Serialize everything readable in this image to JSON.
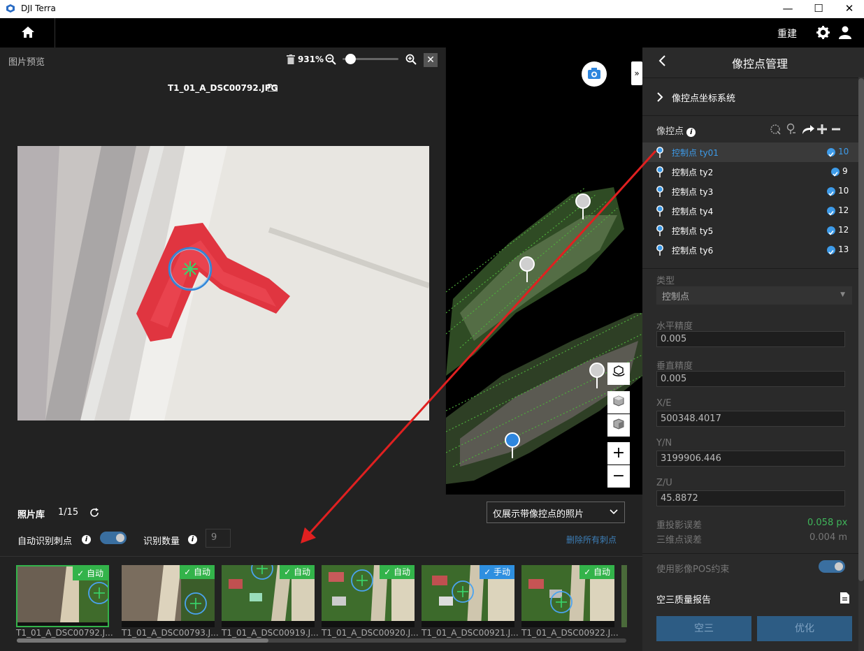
{
  "app": {
    "title": "DJI Terra"
  },
  "window_controls": {
    "minimize": "—",
    "maximize": "☐",
    "close": "✕"
  },
  "topbar": {
    "rebuild_label": "重建"
  },
  "preview": {
    "title": "图片预览",
    "zoom_level": "931%",
    "zoom_slider_value": 0.1,
    "filename": "T1_01_A_DSC00792.JPG",
    "close_label": "✕"
  },
  "map_buttons": {
    "zoom_in": "+",
    "zoom_out": "−",
    "expand": "»"
  },
  "panel": {
    "title": "像控点管理",
    "coord_system_label": "像控点坐标系统",
    "gcp_section_label": "像控点",
    "gcp_list": [
      {
        "name": "控制点   ty01",
        "count": "10",
        "selected": true
      },
      {
        "name": "控制点   ty2",
        "count": "9",
        "selected": false
      },
      {
        "name": "控制点   ty3",
        "count": "10",
        "selected": false
      },
      {
        "name": "控制点   ty4",
        "count": "12",
        "selected": false
      },
      {
        "name": "控制点   ty5",
        "count": "12",
        "selected": false
      },
      {
        "name": "控制点   ty6",
        "count": "13",
        "selected": false
      }
    ],
    "type_label": "类型",
    "type_value": "控制点",
    "horizontal_accuracy_label": "水平精度",
    "horizontal_accuracy_value": "0.005",
    "vertical_accuracy_label": "垂直精度",
    "vertical_accuracy_value": "0.005",
    "x_label": "X/E",
    "x_value": "500348.4017",
    "y_label": "Y/N",
    "y_value": "3199906.446",
    "z_label": "Z/U",
    "z_value": "45.8872",
    "reproj_error_label": "重投影误差",
    "reproj_error_value": "0.058 px",
    "point3d_error_label": "三维点误差",
    "point3d_error_value": "0.004 m",
    "pos_constraint_label": "使用影像POS约束",
    "report_label": "空三质量报告",
    "aerotriangulation_button": "空三",
    "optimize_button": "优化"
  },
  "library": {
    "title": "照片库",
    "count": "1/15",
    "filter_dropdown": "仅展示带像控点的照片",
    "auto_detect_label": "自动识别刺点",
    "detect_count_label": "识别数量",
    "detect_count_value": "9",
    "delete_all_label": "删除所有刺点",
    "thumbnails": [
      {
        "name": "T1_01_A_DSC00792.J...",
        "badge": "自动",
        "badge_type": "auto"
      },
      {
        "name": "T1_01_A_DSC00793.J...",
        "badge": "自动",
        "badge_type": "auto"
      },
      {
        "name": "T1_01_A_DSC00919.J...",
        "badge": "自动",
        "badge_type": "auto"
      },
      {
        "name": "T1_01_A_DSC00920.J...",
        "badge": "自动",
        "badge_type": "auto"
      },
      {
        "name": "T1_01_A_DSC00921.J...",
        "badge": "手动",
        "badge_type": "manual"
      },
      {
        "name": "T1_01_A_DSC00922.J...",
        "badge": "自动",
        "badge_type": "auto"
      }
    ]
  },
  "colors": {
    "accent_blue": "#3d9be9",
    "auto_badge": "#33b34a",
    "manual_badge": "#2e8fe0",
    "reproj_error_green": "#3fb65a",
    "arrow_red": "#e02020"
  }
}
